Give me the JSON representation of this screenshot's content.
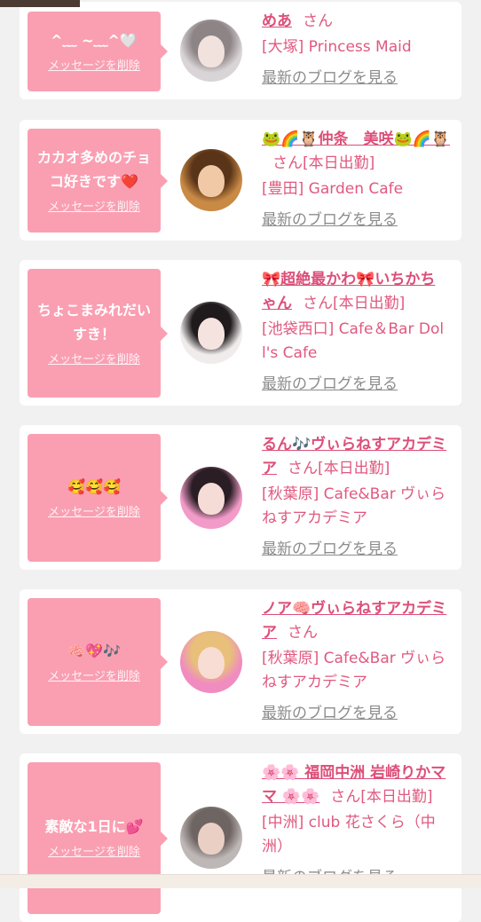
{
  "colors": {
    "page_background": "#f1f1f1",
    "bubble": "#fa9fb2",
    "name_text": "#dc4f79",
    "info_text": "#e0597f",
    "blog_link": "#8c8c8c",
    "top_bar": "#4a3b33",
    "bottom_bar": "#f4ede6"
  },
  "cards": [
    {
      "message": "^﹏ ~﹏^🤍",
      "delete_label": "メッセージを削除",
      "name": "めあ",
      "honorific": "さん",
      "status": "",
      "shop": "[大塚] Princess Maid",
      "blog_link": "最新のブログを見る",
      "avatar_colors": [
        "#d9d4d6",
        "#8d8486",
        "#f2e2de"
      ]
    },
    {
      "message": "カカオ多めのチョコ好きです❤️",
      "delete_label": "メッセージを削除",
      "name": "🐸🌈🦉仲条　美咲🐸🌈🦉",
      "honorific": "さん",
      "status": "[本日出勤]",
      "shop": "[豊田] Garden Cafe",
      "blog_link": "最新のブログを見る",
      "avatar_colors": [
        "#c98a45",
        "#5a3418",
        "#f1c9a6"
      ]
    },
    {
      "message": "ちょこまみれだいすき！",
      "delete_label": "メッセージを削除",
      "name": "🎀超絶最かわ🎀いちかちゃん",
      "honorific": "さん",
      "status": "[本日出勤]",
      "shop": "[池袋西口] Cafe＆Bar Doll's Cafe",
      "blog_link": "最新のブログを見る",
      "avatar_colors": [
        "#f0ecec",
        "#1f1a1c",
        "#f5e3e0"
      ]
    },
    {
      "message": "🥰🥰🥰",
      "delete_label": "メッセージを削除",
      "name": "るん🎶ヴぃらねすアカデミア",
      "honorific": "さん",
      "status": "[本日出勤]",
      "shop": "[秋葉原] Cafe&Bar ヴぃらねすアカデミア",
      "blog_link": "最新のブログを見る",
      "avatar_colors": [
        "#f29bc8",
        "#2a1d24",
        "#f6dcd6"
      ]
    },
    {
      "message": "🧠💖🎶",
      "delete_label": "メッセージを削除",
      "name": "ノア🧠ヴぃらねすアカデミア",
      "honorific": "さん",
      "status": "",
      "shop": "[秋葉原] Cafe&Bar ヴぃらねすアカデミア",
      "blog_link": "最新のブログを見る",
      "avatar_colors": [
        "#f08cc0",
        "#e8c07a",
        "#f7ddd3"
      ]
    },
    {
      "message": "素敵な1日に💕",
      "delete_label": "メッセージを削除",
      "name": "🌸🌸 福岡中洲 岩崎りかママ 🌸🌸",
      "honorific": "さん",
      "status": "[本日出勤]",
      "shop": "[中洲] club 花さくら（中洲）",
      "blog_link": "最新のブログを見る",
      "avatar_colors": [
        "#bdb7b6",
        "#6e6462",
        "#e9cfc4"
      ]
    }
  ]
}
